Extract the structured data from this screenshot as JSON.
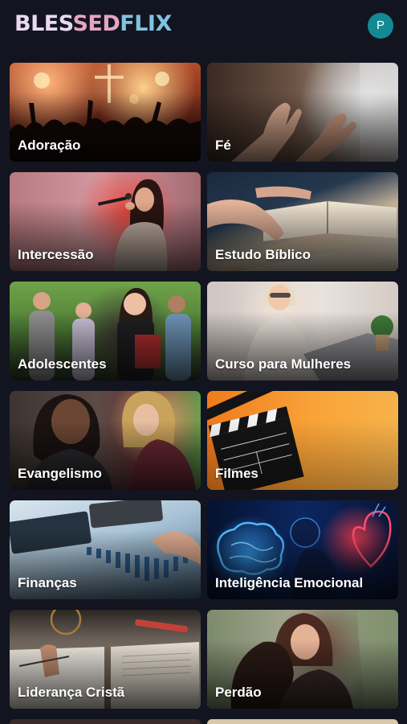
{
  "app": {
    "logo_part1": "BLES",
    "logo_part2": "SED",
    "logo_part3": "FLIX",
    "profile_initial": "P"
  },
  "colors": {
    "background": "#12151f",
    "avatar": "#138a93",
    "logo_light": "#e9d9f2",
    "logo_pink": "#e6a3c3",
    "logo_blue": "#7ec4e0"
  },
  "categories": [
    {
      "label": "Adoração",
      "image": "worship-concert-image"
    },
    {
      "label": "Fé",
      "image": "praying-hands-image"
    },
    {
      "label": "Intercessão",
      "image": "woman-singing-image"
    },
    {
      "label": "Estudo Bíblico",
      "image": "bible-study-image"
    },
    {
      "label": "Adolescentes",
      "image": "teen-group-image"
    },
    {
      "label": "Curso para Mulheres",
      "image": "woman-laptop-image"
    },
    {
      "label": "Evangelismo",
      "image": "two-women-talking-image"
    },
    {
      "label": "Filmes",
      "image": "clapperboard-image"
    },
    {
      "label": "Finanças",
      "image": "calculator-chart-image"
    },
    {
      "label": "Inteligência Emocional",
      "image": "brain-heart-image"
    },
    {
      "label": "Liderança Cristã",
      "image": "open-books-image"
    },
    {
      "label": "Perdão",
      "image": "women-hugging-image"
    }
  ]
}
